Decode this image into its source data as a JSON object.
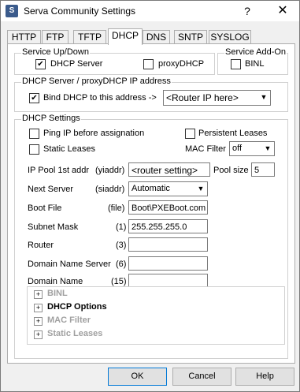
{
  "window": {
    "title": "Serva Community Settings",
    "icon_text": "S",
    "help_glyph": "?",
    "close_glyph": "✕"
  },
  "tabs": [
    {
      "label": "HTTP"
    },
    {
      "label": "FTP"
    },
    {
      "label": "TFTP"
    },
    {
      "label": "DHCP"
    },
    {
      "label": "DNS"
    },
    {
      "label": "SNTP"
    },
    {
      "label": "SYSLOG"
    }
  ],
  "service_updown": {
    "label": "Service Up/Down",
    "dhcp_server": "DHCP Server",
    "dhcp_server_checked": "✔",
    "proxy_dhcp": "proxyDHCP"
  },
  "service_addon": {
    "label": "Service Add-On",
    "binl": "BINL"
  },
  "ip_group": {
    "label": "DHCP Server / proxyDHCP IP address",
    "bind": "Bind DHCP to this address  ->",
    "bind_checked": "✔",
    "router_value": "<Router IP here>"
  },
  "dhcp_settings": {
    "label": "DHCP Settings",
    "ping": "Ping IP before assignation",
    "persistent": "Persistent Leases",
    "static": "Static Leases",
    "mac_filter": "MAC Filter",
    "mac_filter_value": "off",
    "ip_pool_label": "IP Pool 1st addr",
    "ip_pool_tag": "(yiaddr)",
    "ip_pool_value": "<router setting>",
    "pool_size_label": "Pool size",
    "pool_size_value": "5",
    "next_server_label": "Next Server",
    "next_server_tag": "(siaddr)",
    "next_server_value": "Automatic",
    "boot_file_label": "Boot File",
    "boot_file_tag": "(file)",
    "boot_file_value": "Boot\\PXEBoot.com",
    "subnet_label": "Subnet Mask",
    "subnet_tag": "(1)",
    "subnet_value": "255.255.255.0",
    "router_label": "Router",
    "router_tag": "(3)",
    "dns_label": "Domain Name Server",
    "dns_tag": "(6)",
    "domain_label": "Domain Name",
    "domain_tag": "(15)"
  },
  "tree": [
    {
      "label": "BINL",
      "state": "disabled"
    },
    {
      "label": "DHCP Options",
      "state": "enabled"
    },
    {
      "label": "MAC Filter",
      "state": "disabled"
    },
    {
      "label": "Static Leases",
      "state": "disabled"
    }
  ],
  "tree_expander": "+",
  "dropdown_arrow": "▼",
  "buttons": {
    "ok": "OK",
    "cancel": "Cancel",
    "help": "Help"
  }
}
